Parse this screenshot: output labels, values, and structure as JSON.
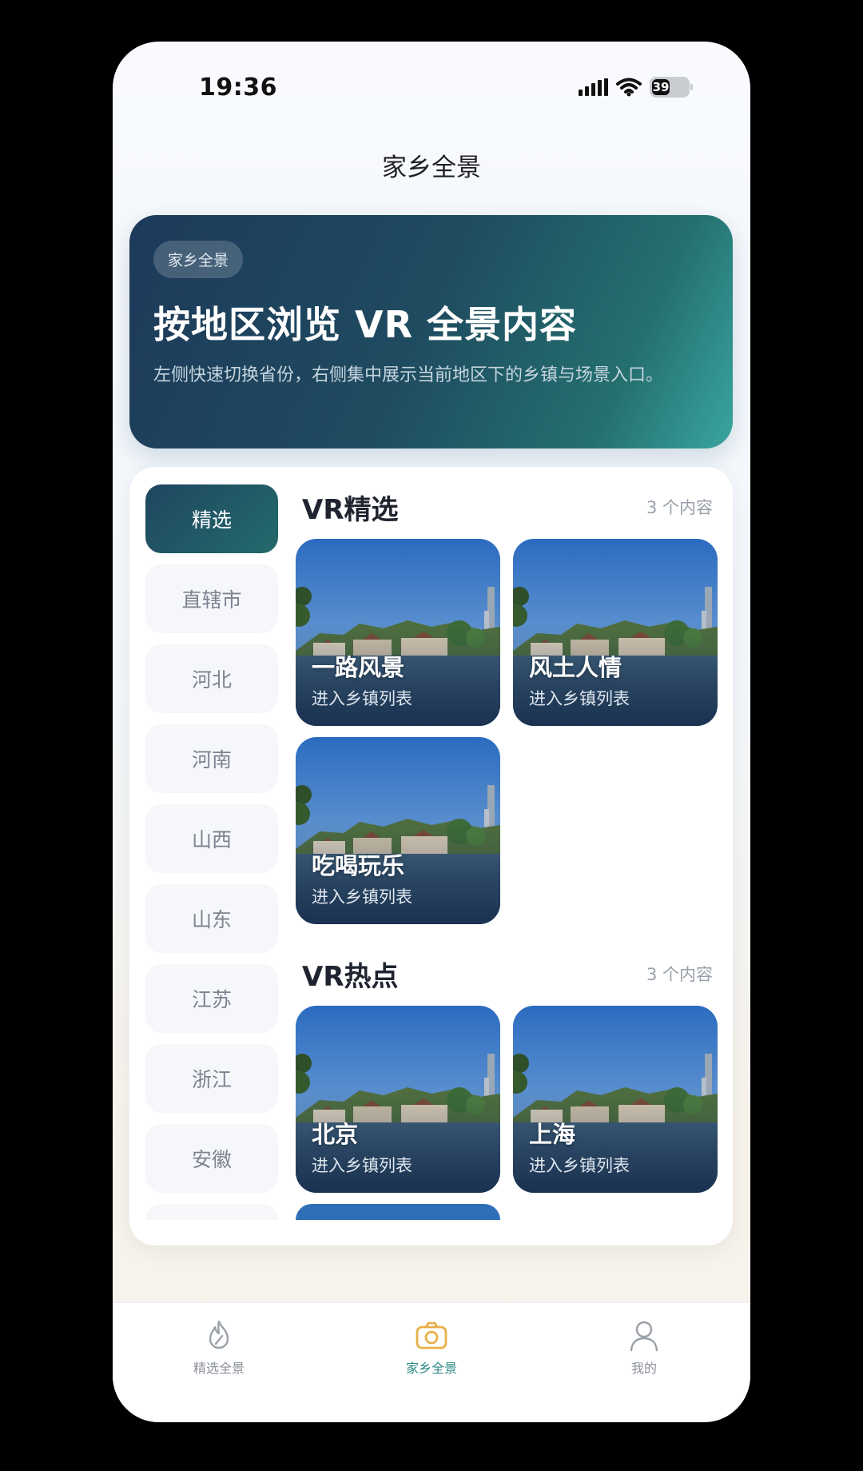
{
  "status_bar": {
    "time": "19:36",
    "battery": "39"
  },
  "nav": {
    "title": "家乡全景"
  },
  "hero": {
    "tag": "家乡全景",
    "title": "按地区浏览 VR 全景内容",
    "description": "左侧快速切换省份，右侧集中展示当前地区下的乡镇与场景入口。"
  },
  "sidebar": {
    "items": [
      {
        "label": "精选",
        "active": true
      },
      {
        "label": "直辖市"
      },
      {
        "label": "河北"
      },
      {
        "label": "河南"
      },
      {
        "label": "山西"
      },
      {
        "label": "山东"
      },
      {
        "label": "江苏"
      },
      {
        "label": "浙江"
      },
      {
        "label": "安徽"
      },
      {
        "label": ""
      }
    ]
  },
  "sections": [
    {
      "title": "VR精选",
      "count": "3 个内容",
      "tiles": [
        {
          "name": "一路风景",
          "sub": "进入乡镇列表"
        },
        {
          "name": "风土人情",
          "sub": "进入乡镇列表"
        },
        {
          "name": "吃喝玩乐",
          "sub": "进入乡镇列表"
        }
      ]
    },
    {
      "title": "VR热点",
      "count": "3 个内容",
      "tiles": [
        {
          "name": "北京",
          "sub": "进入乡镇列表"
        },
        {
          "name": "上海",
          "sub": "进入乡镇列表"
        }
      ]
    }
  ],
  "tabbar": {
    "items": [
      {
        "label": "精选全景",
        "icon": "flame-icon"
      },
      {
        "label": "家乡全景",
        "icon": "camera-icon",
        "active": true
      },
      {
        "label": "我的",
        "icon": "user-icon"
      }
    ]
  },
  "colors": {
    "accent": "#2f8a86",
    "hero_start": "#1d3a5a",
    "hero_end": "#3aa5a0",
    "tab_active_icon": "#e8b04a"
  }
}
